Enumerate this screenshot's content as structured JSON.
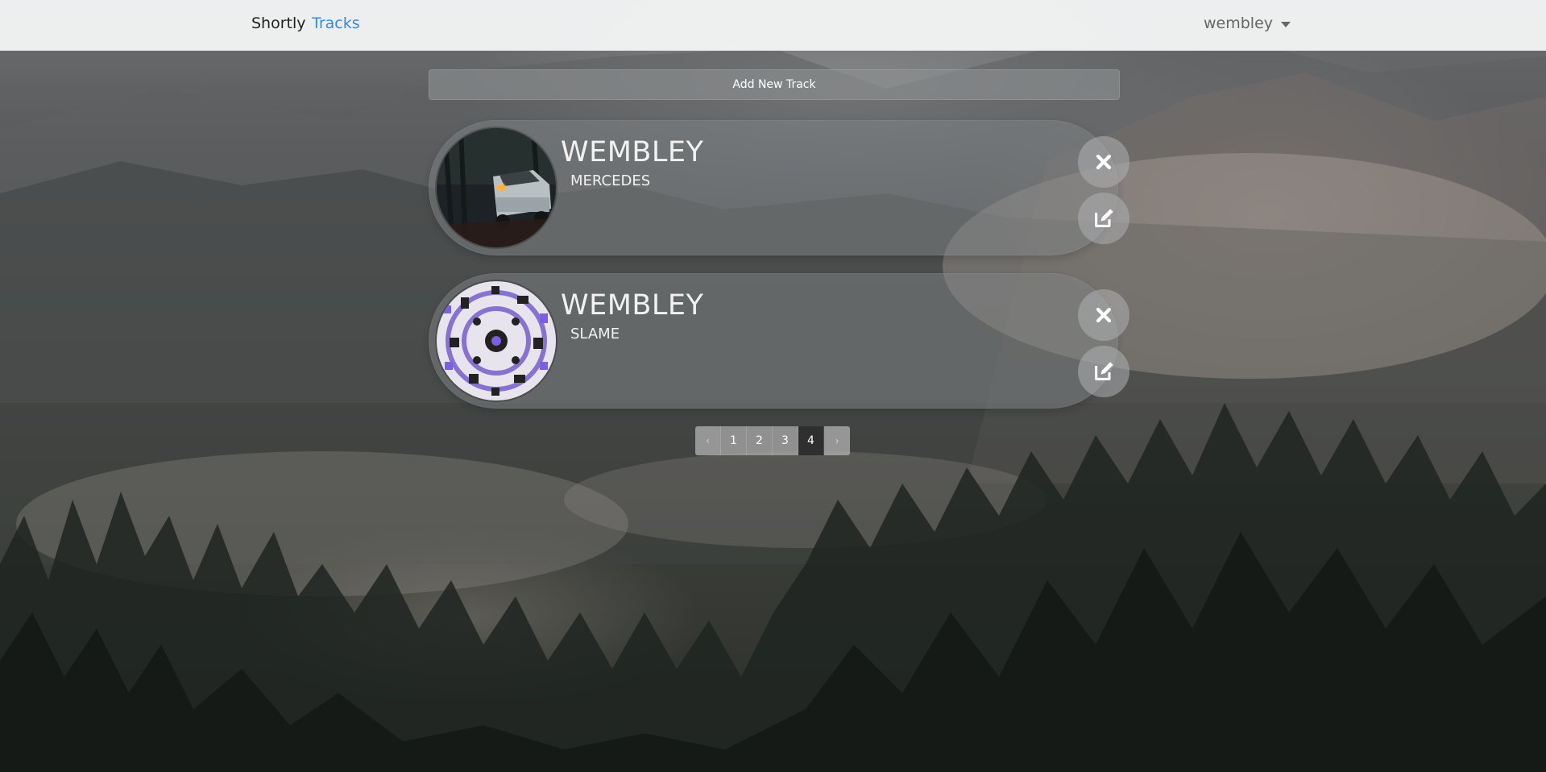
{
  "nav": {
    "brand": "Shortly",
    "tracks_link": "Tracks",
    "user": "wembley"
  },
  "add_button_label": "Add New Track",
  "tracks": [
    {
      "title": "WEMBLEY",
      "artist": "MERCEDES"
    },
    {
      "title": "WEMBLEY",
      "artist": "SLAME"
    }
  ],
  "pagination": {
    "prev": "‹",
    "pages": [
      "1",
      "2",
      "3",
      "4"
    ],
    "active": "4",
    "next": "›"
  },
  "icons": {
    "delete": "close-icon",
    "edit": "edit-icon"
  }
}
